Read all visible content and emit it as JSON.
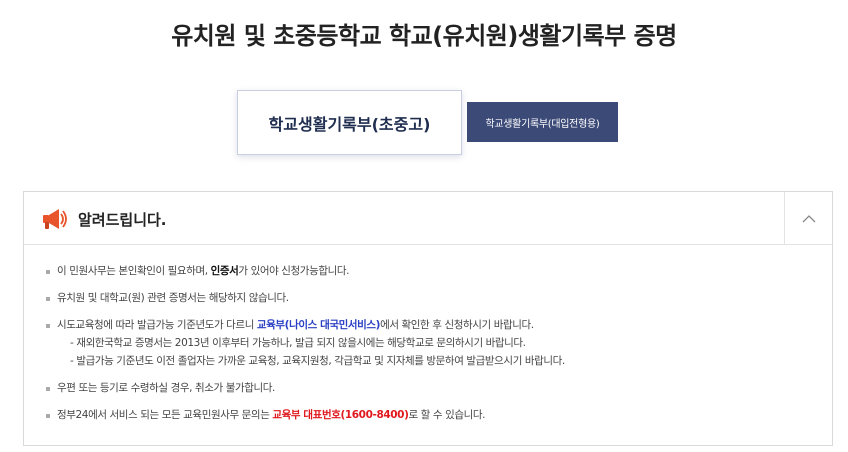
{
  "page": {
    "title": "유치원 및 초중등학교 학교(유치원)생활기록부 증명"
  },
  "tabs": [
    {
      "label": "학교생활기록부(초중고)",
      "selected": true
    },
    {
      "label": "학교생활기록부(대입전형용)",
      "selected": false
    }
  ],
  "notice": {
    "title": "알려드립니다.",
    "icon": "megaphone-icon",
    "collapse_icon": "chevron-up-icon",
    "items": [
      {
        "pre": "이 민원사무는 본인확인이 필요하며, ",
        "strong": "인증서",
        "post": "가 있어야 신청가능합니다."
      },
      {
        "text": "유치원 및 대학교(원) 관련 증명서는 해당하지 않습니다."
      },
      {
        "pre": "시도교육청에 따라 발급가능 기준년도가 다르니 ",
        "strong": "교육부(나이스 대국민서비스)",
        "post": "에서 확인한 후 신청하시기 바랍니다.",
        "sub": [
          "- 재외한국학교 증명서는 2013년 이후부터 가능하나, 발급 되지 않을시에는 해당학교로 문의하시기 바랍니다.",
          "- 발급가능 기준년도 이전 졸업자는 가까운 교육청, 교육지원청, 각급학교 및 지자체를 방문하여 발급받으시기 바랍니다."
        ]
      },
      {
        "text": "우편 또는 등기로 수령하실 경우, 취소가 불가합니다."
      },
      {
        "pre": "정부24에서 서비스 되는 모든 교육민원사무 문의는 ",
        "strong": "교육부 대표번호(1600-8400)",
        "post": "로 할 수 있습니다."
      }
    ]
  },
  "colors": {
    "accent_navy": "#3c4a78",
    "highlight_blue": "#2b3fc4",
    "highlight_red": "#e1181d",
    "megaphone": "#e8542c"
  }
}
